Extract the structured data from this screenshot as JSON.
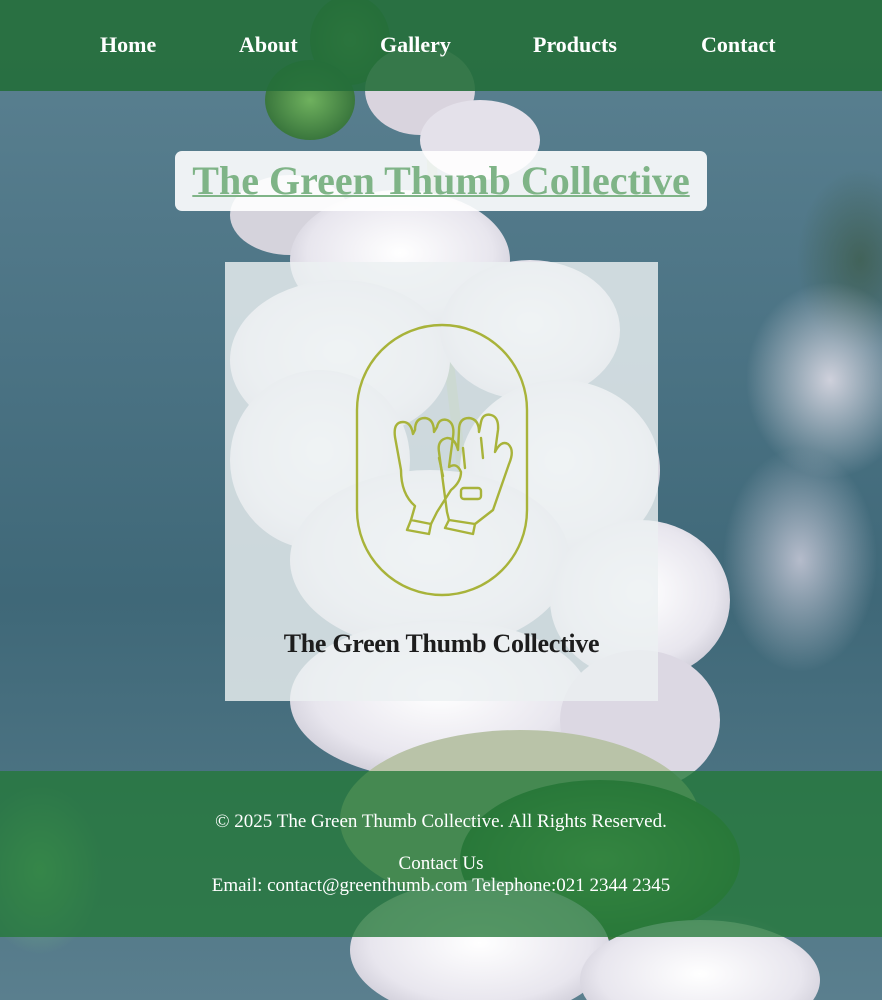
{
  "nav": {
    "items": [
      {
        "label": "Home"
      },
      {
        "label": "About"
      },
      {
        "label": "Gallery"
      },
      {
        "label": "Products"
      },
      {
        "label": "Contact"
      }
    ]
  },
  "header": {
    "title": "The Green Thumb Collective"
  },
  "logo": {
    "icon": "gardening-gloves-icon",
    "text": "The Green Thumb Collective",
    "color": "#a8b33a"
  },
  "footer": {
    "copyright": "© 2025 The Green Thumb Collective. All Rights Reserved.",
    "contact_heading": "Contact Us",
    "email_label": "Email:",
    "email": "contact@greenthumb.com",
    "telephone_label": "Telephone:",
    "telephone": "021 2344 2345"
  },
  "colors": {
    "nav_bg": "#246e3a",
    "footer_bg": "#247838",
    "title_text": "#7fb487",
    "background": "#4a7384"
  }
}
